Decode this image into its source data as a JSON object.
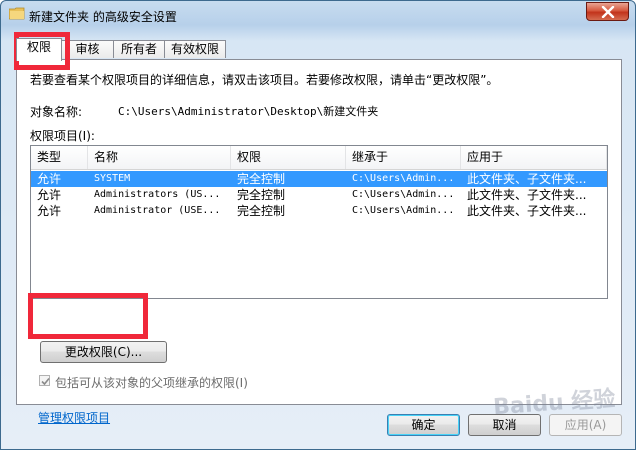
{
  "window": {
    "title": "新建文件夹 的高级安全设置"
  },
  "tabs": [
    {
      "label": "权限"
    },
    {
      "label": "审核"
    },
    {
      "label": "所有者"
    },
    {
      "label": "有效权限"
    }
  ],
  "info_text": "若要查看某个权限项目的详细信息，请双击该项目。若要修改权限，请单击“更改权限”。",
  "object": {
    "label": "对象名称:",
    "value": "C:\\Users\\Administrator\\Desktop\\新建文件夹"
  },
  "entries_label": "权限项目(I):",
  "table": {
    "headers": [
      "类型",
      "名称",
      "权限",
      "继承于",
      "应用于"
    ],
    "rows": [
      {
        "type": "允许",
        "name": "SYSTEM",
        "perm": "完全控制",
        "inherited": "C:\\Users\\Admin...",
        "applies": "此文件夹、子文件夹...",
        "selected": true
      },
      {
        "type": "允许",
        "name": "Administrators (US...",
        "perm": "完全控制",
        "inherited": "C:\\Users\\Admin...",
        "applies": "此文件夹、子文件夹...",
        "selected": false
      },
      {
        "type": "允许",
        "name": "Administrator (USE...",
        "perm": "完全控制",
        "inherited": "C:\\Users\\Admin...",
        "applies": "此文件夹、子文件夹...",
        "selected": false
      }
    ]
  },
  "change_perm_button": "更改权限(C)...",
  "inherit_checkbox": {
    "label": "包括可从该对象的父项继承的权限(I)",
    "checked": true
  },
  "manage_link": "管理权限项目",
  "buttons": {
    "ok": "确定",
    "cancel": "取消",
    "apply": "应用(A)"
  },
  "watermark": "Baidu 经验",
  "colors": {
    "selection": "#3399ff",
    "highlight": "#f0283a",
    "link": "#0066cc"
  }
}
